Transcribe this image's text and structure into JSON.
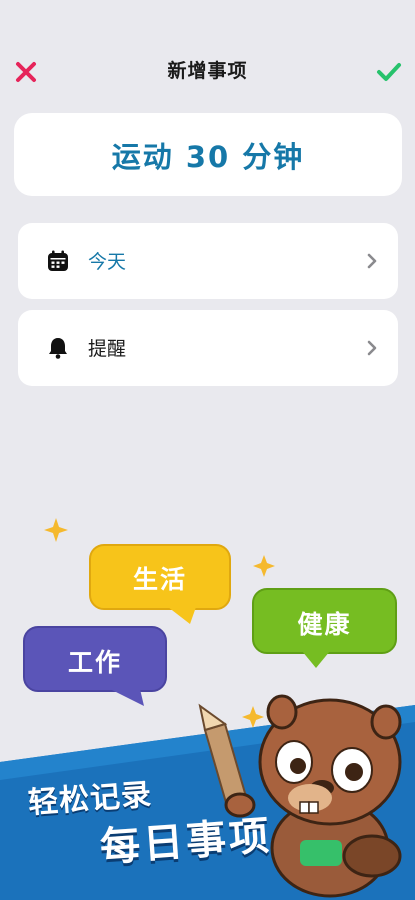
{
  "nav": {
    "title": "新增事项",
    "close_icon": "close-icon",
    "confirm_icon": "checkmark-icon"
  },
  "task": {
    "title": "运动 30 分钟"
  },
  "options": [
    {
      "icon": "calendar-icon",
      "label": "今天"
    },
    {
      "icon": "bell-icon",
      "label": "提醒"
    }
  ],
  "promo": {
    "bubbles": [
      "生活",
      "健康",
      "工作"
    ],
    "slogan_line1": "轻松记录",
    "slogan_line2": "每日事项"
  },
  "colors": {
    "close": "#e6245a",
    "confirm": "#27c26c",
    "accent": "#1678a8",
    "bubble_life": "#f7c41a",
    "bubble_health": "#76bd22",
    "bubble_work": "#5b55b8",
    "banner": "#1b72bb"
  }
}
